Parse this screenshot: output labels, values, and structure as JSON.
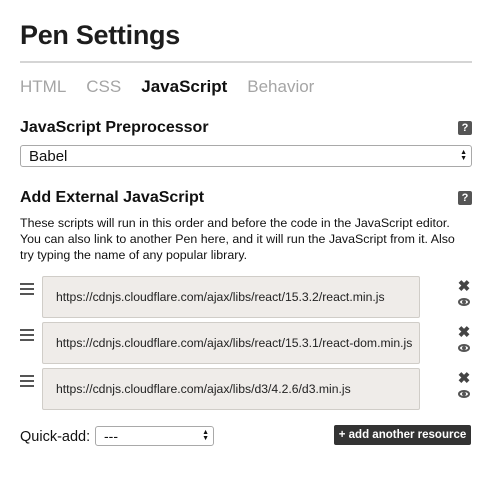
{
  "header": {
    "title": "Pen Settings"
  },
  "tabs": [
    {
      "label": "HTML",
      "active": false
    },
    {
      "label": "CSS",
      "active": false
    },
    {
      "label": "JavaScript",
      "active": true
    },
    {
      "label": "Behavior",
      "active": false
    }
  ],
  "preprocessor": {
    "label": "JavaScript Preprocessor",
    "help_icon": "?",
    "selected": "Babel"
  },
  "external": {
    "label": "Add External JavaScript",
    "help_icon": "?",
    "description": "These scripts will run in this order and before the code in the JavaScript editor. You can also link to another Pen here, and it will run the JavaScript from it. Also try typing the name of any popular library.",
    "resources": [
      "https://cdnjs.cloudflare.com/ajax/libs/react/15.3.2/react.min.js",
      "https://cdnjs.cloudflare.com/ajax/libs/react/15.3.1/react-dom.min.js",
      "https://cdnjs.cloudflare.com/ajax/libs/d3/4.2.6/d3.min.js"
    ],
    "remove_glyph": "✖"
  },
  "quick_add": {
    "label": "Quick-add:",
    "selected": "---"
  },
  "add_resource_label": "+ add another resource",
  "colors": {
    "accent_dark": "#333333",
    "input_bg": "#efece9",
    "muted_tab": "#a5a5a5"
  }
}
